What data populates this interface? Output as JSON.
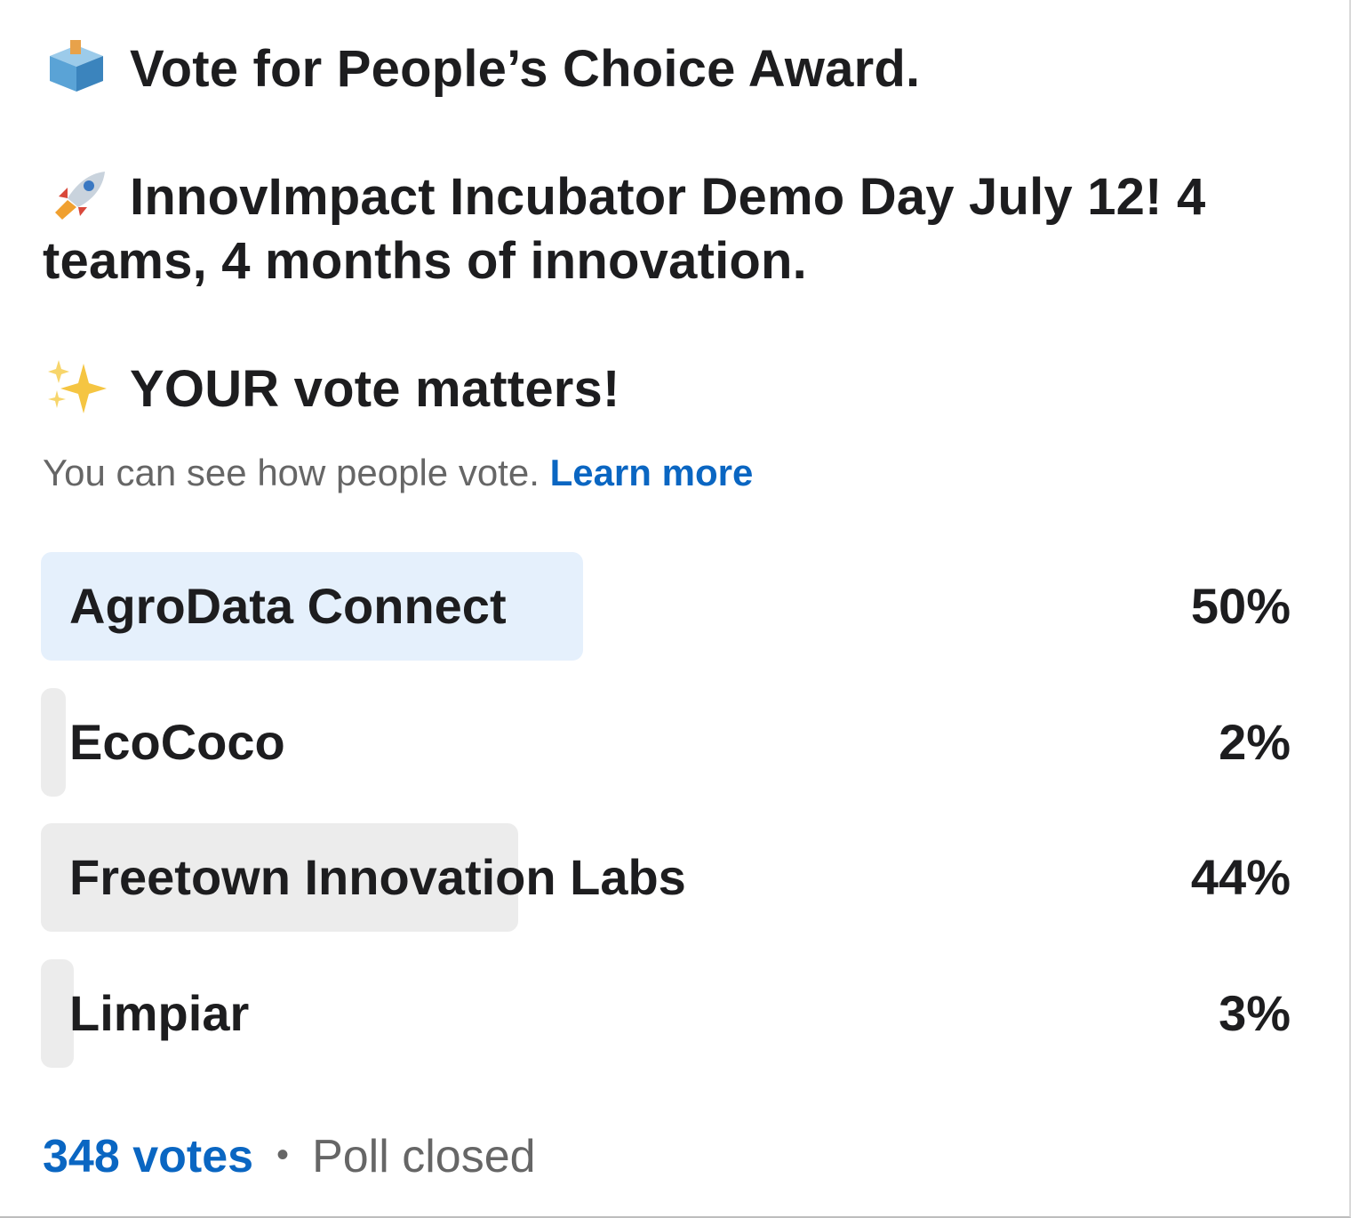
{
  "post": {
    "line1": "Vote for People’s Choice Award.",
    "line1_icon": "ballot-box-icon",
    "line2": "InnovImpact Incubator Demo Day July 12! 4 teams, 4 months of innovation.",
    "line2_icon": "rocket-icon",
    "line3": "YOUR vote matters!",
    "line3_icon": "sparkles-icon"
  },
  "poll": {
    "visibility_note": "You can see how people vote.",
    "learn_more": "Learn more",
    "options": [
      {
        "label": "AgroData Connect",
        "percent_text": "50%",
        "percent": 50,
        "winner": true
      },
      {
        "label": "EcoCoco",
        "percent_text": "2%",
        "percent": 2,
        "winner": false
      },
      {
        "label": "Freetown Innovation Labs",
        "percent_text": "44%",
        "percent": 44,
        "winner": false
      },
      {
        "label": "Limpiar",
        "percent_text": "3%",
        "percent": 3,
        "winner": false
      }
    ],
    "votes": "348 votes",
    "separator": "•",
    "status": "Poll closed"
  },
  "colors": {
    "accent": "#0a66c2",
    "winner_fill": "#e5f0fc",
    "option_fill": "#ececec",
    "muted_text": "#666666"
  }
}
